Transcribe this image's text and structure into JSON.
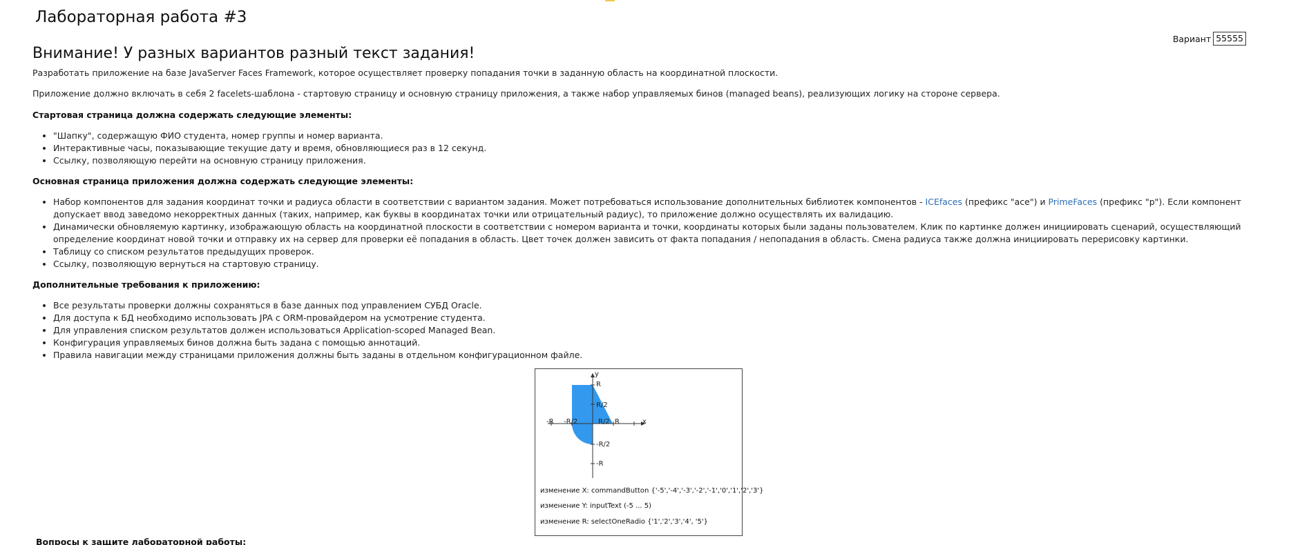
{
  "page": {
    "title": "Лабораторная работа #3",
    "variant": {
      "label": "Вариант",
      "value": "55555"
    },
    "warning": "Внимание! У разных вариантов разный текст задания!",
    "paragraph_1": "Разработать приложение на базе JavaServer Faces Framework, которое осуществляет проверку попадания точки в заданную область на координатной плоскости.",
    "paragraph_2": "Приложение должно включать в себя 2 facelets-шаблона - стартовую страницу и основную страницу приложения, а также набор управляемых бинов (managed beans), реализующих логику на стороне сервера.",
    "start_section": {
      "heading": "Стартовая страница должна содержать следующие элементы:",
      "items": [
        "\"Шапку\", содержащую ФИО студента, номер группы и номер варианта.",
        "Интерактивные часы, показывающие текущие дату и время, обновляющиеся раз в 12 секунд.",
        "Ссылку, позволяющую перейти на основную страницу приложения."
      ]
    },
    "main_section": {
      "heading": "Основная страница приложения должна содержать следующие элементы:",
      "item_1": {
        "before": "Набор компонентов для задания координат точки и радиуса области в соответствии с вариантом задания. Может потребоваться использование дополнительных библиотек компонентов - ",
        "link_1": "ICEfaces",
        "middle": " (префикс \"ace\") и ",
        "link_2": "PrimeFaces",
        "after": " (префикс \"p\"). Если компонент допускает ввод заведомо некорректных данных (таких, например, как буквы в координатах точки или отрицательный радиус), то приложение должно осуществлять их валидацию."
      },
      "items": [
        "Динамически обновляемую картинку, изображающую область на координатной плоскости в соответствии с номером варианта и точки, координаты которых были заданы пользователем. Клик по картинке должен инициировать сценарий, осуществляющий определение координат новой точки и отправку их на сервер для проверки её попадания в область. Цвет точек должен зависить от факта попадания / непопадания в область. Смена радиуса также должна инициировать перерисовку картинки.",
        "Таблицу со списком результатов предыдущих проверок.",
        "Ссылку, позволяющую вернуться на стартовую страницу."
      ]
    },
    "extra_section": {
      "heading": "Дополнительные требования к приложению:",
      "items": [
        "Все результаты проверки должны сохраняться в базе данных под управлением СУБД Oracle.",
        "Для доступа к БД необходимо использовать JPA с ORM-провайдером на усмотрение студента.",
        "Для управления списком результатов должен использоваться Application-scoped Managed Bean.",
        "Конфигурация управляемых бинов должна быть задана с помощью аннотаций.",
        "Правила навигации между страницами приложения должны быть заданы в отдельном конфигурационном файле."
      ]
    },
    "diagram": {
      "labels": {
        "y": "y",
        "x": "x",
        "R_top": "R",
        "R_half_top": "R/2",
        "R_left": "-R",
        "R_half_left": "-R/2",
        "R_half_right": "R/2",
        "R_right": "R",
        "R_half_bottom": "-R/2",
        "R_bottom": "-R"
      },
      "fill_color": "#3399ee",
      "lines": [
        "изменение X: commandButton {'-5','-4','-3','-2','-1','0','1','2','3'}",
        "изменение Y: inputText (-5 ... 5)",
        "изменение R: selectOneRadio {'1','2','3','4', '5'}"
      ]
    },
    "bottom_heading": "Вопросы к защите лабораторной работы:"
  }
}
